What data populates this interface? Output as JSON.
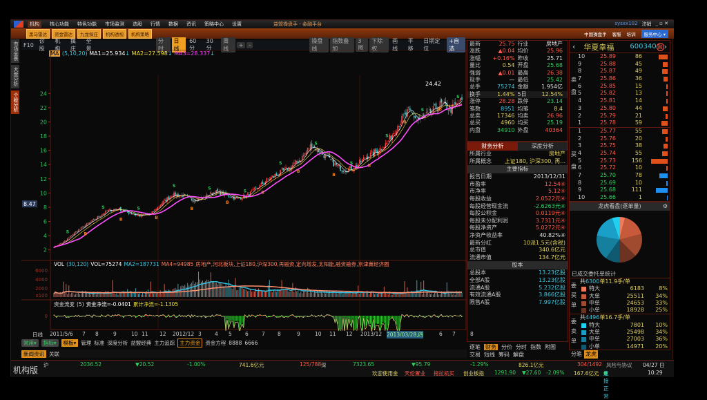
{
  "app": {
    "title": "益盟操盘手 - 金融平台",
    "menu": [
      "机构",
      "核心功能",
      "特色功能",
      "市场监测",
      "选股",
      "行情",
      "数据",
      "资讯",
      "策略中心",
      "设置"
    ],
    "user": "sysxx102",
    "logout": "注销",
    "toolbar_buttons": [
      "黑马雷达",
      "资金雷达",
      "九龙探庄",
      "机构透视",
      "机构策略"
    ],
    "right_links": [
      "中国操盘手",
      "客服",
      "培训"
    ],
    "service_center": "服务中心"
  },
  "left_tabs": [
    "市场全景",
    "大盘分析",
    "个股分析"
  ],
  "chart_toolbar": {
    "left": [
      "F10",
      "诊股",
      "机构",
      "擒庄",
      "全景"
    ],
    "periods": [
      "分时",
      "日线",
      "60分",
      "30分",
      "周线"
    ],
    "selected_period": "日线",
    "zoom": [
      "+",
      "-"
    ],
    "right": [
      "操盘线",
      "指数叠加",
      "3图",
      "下除权"
    ],
    "plain": [
      "画线",
      "平移",
      "日期定位"
    ],
    "fav": "+自选"
  },
  "ma_legend": {
    "name": "MA",
    "params": "(5,10,20)",
    "ma1": "MA1=25.934",
    "ma2": "MA2=27.598",
    "ma3": "MA3=28.337"
  },
  "price_label": "8.47",
  "peak_label": "24.42",
  "volume_legend": {
    "name": "VOL",
    "params": "(30,120)",
    "vol": "VOL=75274",
    "ma2": "MA2=187731",
    "ma4": "MA4=94985",
    "tags": "房地产,河北板块,上证180,沪深300,再融资,定向增发,太阳能,融资融券,京津冀经济圈",
    "unit": "x100"
  },
  "flow_legend": {
    "name": "资金流变",
    "params": "(5)",
    "net": "资金净流=-0.0401",
    "cum": "累计净流=-1.1305"
  },
  "chart_data": {
    "type": "candlestick",
    "price_ylim": [
      1,
      25
    ],
    "price_ticks": [
      2,
      4,
      6,
      8,
      10,
      12,
      14,
      16,
      18,
      20,
      22,
      24
    ],
    "volume_ticks": [
      2000,
      4000,
      6000
    ],
    "flow_ticks": [
      0,
      -1
    ],
    "price_path": [
      2.4,
      3.2,
      4.5,
      5.5,
      6.5,
      7.5,
      7.8,
      7.2,
      6.8,
      7.0,
      8.5,
      9.8,
      9.6,
      9.0,
      9.4,
      10.2,
      9.8,
      9.2,
      9.6,
      10.8,
      12.0,
      12.8,
      13.6,
      14.8,
      16.8,
      15.5,
      14.2,
      13.2,
      13.6,
      15.0,
      15.8,
      17.0,
      19.5,
      21.5,
      20.2,
      21.2,
      22.5,
      21.8,
      23.0
    ],
    "time_labels": [
      "2011/5/6",
      "7",
      "8",
      "9",
      "10",
      "11",
      "12",
      "2012/12",
      "3",
      "4",
      "5",
      "6",
      "7",
      "8",
      "9",
      "10",
      "11",
      "12",
      "2013/12",
      "2013/03/28,四",
      "6",
      "7",
      "8"
    ],
    "period_label": "日线"
  },
  "bottom_tabs": {
    "dropdowns": [
      "常用",
      "指标",
      "模板"
    ],
    "items": [
      "管理",
      "标准",
      "深度分析",
      "益盟经典",
      "主力追踪",
      "主力资金",
      "资金方程",
      "8888",
      "6666"
    ],
    "selected": "主力资金"
  },
  "news_tabs": [
    "新闻资讯",
    "关联"
  ],
  "quote": {
    "rows": [
      [
        "最新",
        "25.75",
        "行业",
        "房地产"
      ],
      [
        "涨跌",
        "▲0.04",
        "均价",
        "25.96"
      ],
      [
        "涨幅",
        "+0.16%",
        "昨收",
        "25.71"
      ],
      [
        "量比",
        "0.54",
        "开盘",
        "25.68"
      ],
      [
        "强弱",
        "▲0.01",
        "最高",
        "26.38"
      ],
      [
        "现手",
        "—",
        "最低",
        "25.42"
      ],
      [
        "总手",
        "75274",
        "金额",
        "1.954亿"
      ],
      [
        "换手",
        "1.44%",
        "5日",
        "12.54%"
      ],
      [
        "涨停",
        "28.28",
        "跌停",
        "23.14"
      ],
      [
        "笔数",
        "8951",
        "均笔",
        "8.4"
      ],
      [
        "总卖",
        "17346",
        "均卖",
        "26.96"
      ],
      [
        "总买",
        "4960",
        "均买",
        "25.19"
      ],
      [
        "内盘",
        "34910",
        "外盘",
        "40364"
      ]
    ]
  },
  "fin": {
    "tabs": [
      "财务分析",
      "深度分析"
    ],
    "industry": [
      "所属行业",
      "房地产"
    ],
    "concept": [
      "所属概念",
      "上证180, 沪深300, 再..."
    ],
    "main_title": "主要指标",
    "rows": [
      [
        "报告日期",
        "2013/12/31"
      ],
      [
        "市盈率",
        "12.54④"
      ],
      [
        "市净率",
        "5.12④"
      ],
      [
        "每股收益",
        "2.0522元④"
      ],
      [
        "每股经营现金流",
        "-2.6263元④"
      ],
      [
        "每股公积金",
        "0.0119元④"
      ],
      [
        "每股未分配利润",
        "3.7311元④"
      ],
      [
        "每股净资产",
        "5.0272元④"
      ],
      [
        "净资产收益率",
        "40.82%④"
      ],
      [
        "最新分红",
        "10派1.5元(含税)"
      ],
      [
        "总市值",
        "340.6亿元"
      ],
      [
        "流通市值",
        "134.7亿元"
      ]
    ],
    "share_title": "股本",
    "share_rows": [
      [
        "总股本",
        "13.23亿股"
      ],
      [
        "全部A股",
        "13.23亿股"
      ],
      [
        "流通A股",
        "5.232亿股"
      ],
      [
        "有效流通A股",
        "3.866亿股"
      ],
      [
        "限售A股",
        "7.997亿股"
      ]
    ],
    "bottom_tabs": [
      "逐笔",
      "财务",
      "分价",
      "分时",
      "指数",
      "附图",
      "交易",
      "短线",
      "筹码",
      "解盘"
    ],
    "selected": "财务"
  },
  "book": {
    "name": "华夏幸福",
    "code": "600340",
    "badge": "融",
    "sell_label": "卖盘",
    "buy_label": "买盘",
    "sell": [
      [
        "10",
        "25.89",
        "86"
      ],
      [
        "9",
        "25.88",
        "45"
      ],
      [
        "8",
        "25.87",
        "49"
      ],
      [
        "7",
        "25.86",
        "36"
      ],
      [
        "6",
        "25.85",
        "15"
      ],
      [
        "5",
        "25.82",
        "13"
      ],
      [
        "4",
        "25.81",
        "14"
      ],
      [
        "3",
        "25.80",
        "44"
      ],
      [
        "2",
        "25.79",
        "21"
      ],
      [
        "1",
        "25.78",
        "59"
      ]
    ],
    "buy": [
      [
        "1",
        "25.77",
        "55"
      ],
      [
        "2",
        "25.76",
        "20"
      ],
      [
        "3",
        "25.75",
        "38"
      ],
      [
        "4",
        "25.74",
        "55"
      ],
      [
        "5",
        "25.73",
        "156"
      ],
      [
        "6",
        "25.72",
        "10"
      ],
      [
        "7",
        "25.70",
        "78"
      ],
      [
        "8",
        "25.69",
        "10"
      ],
      [
        "9",
        "25.68",
        "111"
      ],
      [
        "10",
        "25.66",
        "1"
      ]
    ]
  },
  "longhu": {
    "title": "龙虎看盘(逐单量)",
    "stat_title": "已成交委托单统计",
    "buy": {
      "label": "委买单",
      "summary_pre": "共",
      "count": "6300",
      "summary_post": "单11.9手/单",
      "rows": [
        [
          "特大",
          "6183",
          "8%"
        ],
        [
          "大单",
          "25511",
          "34%"
        ],
        [
          "中单",
          "24653",
          "33%"
        ],
        [
          "小单",
          "18928",
          "25%"
        ]
      ]
    },
    "sell": {
      "label": "委卖单",
      "summary_pre": "共",
      "count": "4496",
      "summary_post": "单16.7手/单",
      "rows": [
        [
          "特大",
          "7801",
          "10%"
        ],
        [
          "大单",
          "25498",
          "34%"
        ],
        [
          "中单",
          "27003",
          "36%"
        ],
        [
          "小单",
          "14971",
          "20%"
        ]
      ]
    },
    "colors_buy": [
      "#f07a5a",
      "#c85a3c",
      "#a04a30",
      "#6e3222"
    ],
    "colors_sell": [
      "#20d0f0",
      "#1aa0c8",
      "#15809e",
      "#0f5a70"
    ],
    "tabs": [
      "分笔",
      "龙虎"
    ]
  },
  "status": {
    "brand": "机构版",
    "sh": {
      "name": "沪",
      "value": "2036.52",
      "chg": "▼20.52",
      "pct": "-1.00%",
      "amt": "741.6亿元",
      "ratio": "125/788"
    },
    "sz": {
      "name": "深",
      "value": "7323.65",
      "chg": "▼95.79",
      "pct": "-1.29%",
      "amt": "826.1亿元",
      "ratio": "304/1492"
    },
    "ticker": [
      "欢迎使用金",
      "天伦置业",
      "拖拉机买"
    ],
    "cy": {
      "name": "创业板指",
      "value": "1291.90",
      "chg": "▼27.60",
      "pct": "-2.09%",
      "amt": "167.6亿元"
    },
    "risk": "风险与协议",
    "conn": "连接正常",
    "date": "04/27 日",
    "time": "10:29"
  }
}
